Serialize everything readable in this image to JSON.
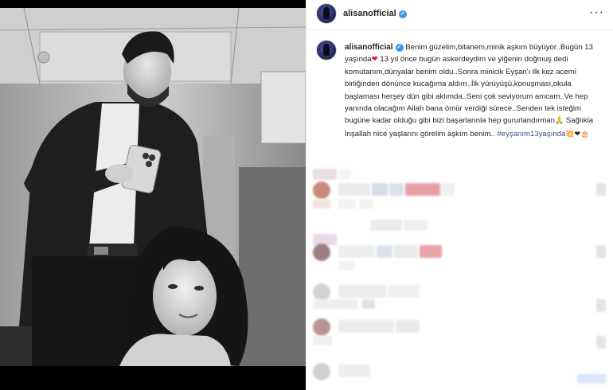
{
  "post": {
    "author": {
      "username": "alisanofficial",
      "verified": true,
      "avatar_icon": "profile-avatar"
    },
    "more_icon": "more-options-icon",
    "more_label": "···",
    "caption": {
      "username": "alisanofficial",
      "line1": "Benim güzelim,bitanem,minik aşkım büyüyor..Bugün 13 yaşında",
      "line2": " 13 yıl önce bugün askerdeydim ve yiğenin doğmuş dedi komutanım,dünyalar benim oldu..Sonra minicik Eyşan'ı ilk kez acemi birliğinden dönünce kucağıma aldım..İlk yürüyüşü,konuşması,okula başlaması herşey dün gibi aklımda..Seni çok seviyorum amcam..Ve hep yanında olacağım Allah bana ömür verdiği sürece..Senden tek isteğim bugüne kadar olduğu gibi bizi başarlarınla hep gururlandırman",
      "line3": " Sağlıkla İnşallah nice yaşlarını görelim aşkım benim..",
      "hashtag": "#eyşanım13yaşında",
      "heart_emoji": "❤",
      "pray_emoji": "🙏",
      "end_emojis": "💥❤🎂",
      "colors": {
        "hashtag": "#385185",
        "heart": "#d9152b",
        "verified": "#3897f0"
      }
    },
    "photo": {
      "style": "black-and-white"
    },
    "comments": {
      "state": "blurred"
    }
  }
}
